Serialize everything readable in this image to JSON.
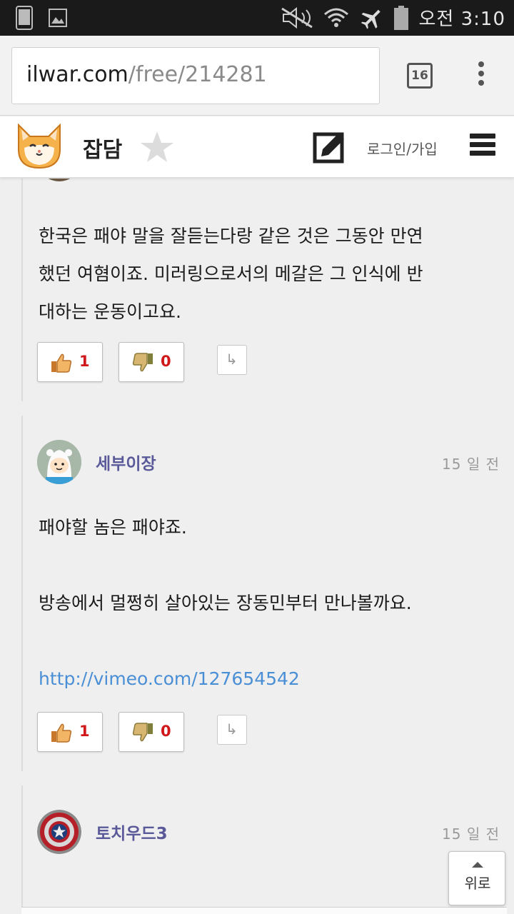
{
  "status_bar": {
    "clock": "오전 3:10",
    "icons": [
      "phone-icon",
      "image-icon",
      "mute-icon",
      "wifi-icon",
      "airplane-icon",
      "battery-icon"
    ]
  },
  "browser": {
    "url_host": "ilwar.com",
    "url_path": "/free/214281",
    "tab_count": "16"
  },
  "header": {
    "board_title": "잡담",
    "login_label": "로그인/가입"
  },
  "comments": [
    {
      "text_lines": [
        "한국은 패야 말을 잘듣는다랑 같은 것은 그동안 만연",
        "했던 여혐이죠. 미러링으로서의 메갈은 그 인식에 반",
        "대하는 운동이고요."
      ],
      "up": "1",
      "down": "0"
    },
    {
      "nick": "세부이장",
      "date": "15 일 전",
      "text_lines": [
        "패야할 놈은 패야죠.",
        "",
        "방송에서 멀쩡히 살아있는 장동민부터 만나볼까요.",
        "",
        "http://vimeo.com/127654542"
      ],
      "up": "1",
      "down": "0"
    },
    {
      "nick": "토치우드3",
      "date": "15 일 전"
    }
  ],
  "scroll_top_label": "위로",
  "colors": {
    "nick": "#5a5a9a",
    "vote_count": "#d0171a",
    "link": "#4a8fd6",
    "status_bar_bg": "#1a1a1a"
  }
}
